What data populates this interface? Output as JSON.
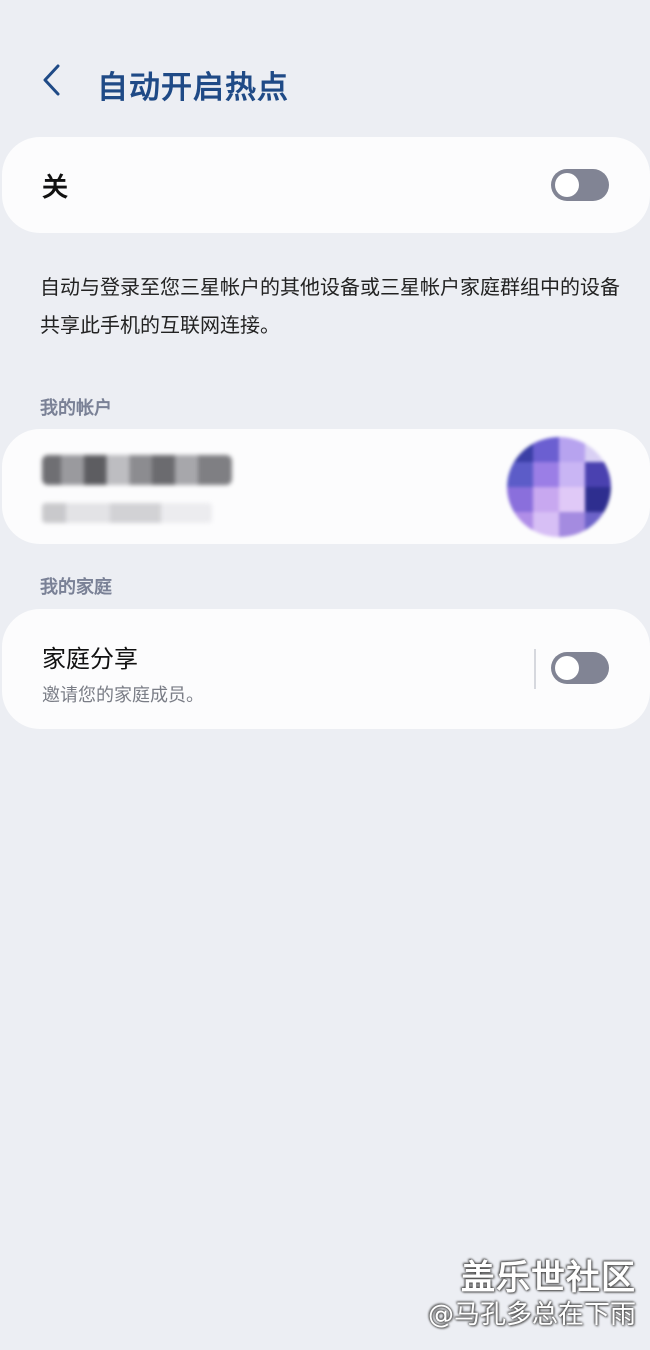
{
  "header": {
    "title": "自动开启热点",
    "back_icon": "chevron-left-icon"
  },
  "master_switch": {
    "label": "关",
    "checked": false
  },
  "description": "自动与登录至您三星帐户的其他设备或三星帐户家庭群组中的设备共享此手机的互联网连接。",
  "sections": {
    "account_header": "我的帐户",
    "family_header": "我的家庭"
  },
  "account": {
    "name": "",
    "email": ""
  },
  "family": {
    "title": "家庭分享",
    "subtitle": "邀请您的家庭成员。",
    "checked": false
  },
  "colors": {
    "background": "#eceef3",
    "card": "#fcfcfd",
    "title": "#1f4a86",
    "toggle_off": "#818494",
    "section_header": "#7a8196"
  },
  "watermark": {
    "line1": "盖乐世社区",
    "line2": "@马孔多总在下雨"
  }
}
